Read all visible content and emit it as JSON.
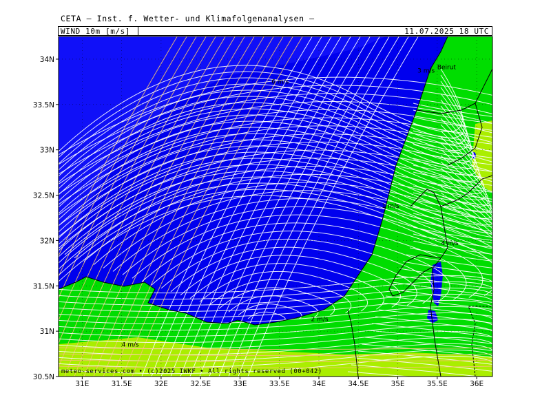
{
  "header": {
    "source": "CETA — Inst. f. Wetter- und Klimafolgenanalysen —",
    "variable": "WIND 10m [m/s]",
    "datetime": "11.07.2025 18 UTC"
  },
  "footer": {
    "credit": "meteo-services.com • (c)2025 IWKF • All rights reserved (00+042)"
  },
  "map": {
    "lon_range": [
      30.7,
      36.2
    ],
    "lat_range": [
      30.5,
      34.25
    ],
    "lon_ticks": [
      "31E",
      "31.5E",
      "32E",
      "32.5E",
      "33E",
      "33.5E",
      "34E",
      "34.5E",
      "35E",
      "35.5E",
      "36E"
    ],
    "lat_ticks": [
      "30.5N",
      "31N",
      "31.5N",
      "32N",
      "32.5N",
      "33N",
      "33.5N",
      "34N"
    ],
    "colors": {
      "sea_strong": "#0000ee",
      "land_light": "#00dd00",
      "land_weak": "#aaee00",
      "streamline_sea": "#ffffff",
      "streamline_fast": "#f4c070"
    },
    "place_labels": [
      {
        "text": "Beirut",
        "lon": 35.5,
        "lat": 33.89
      }
    ],
    "speed_labels": [
      {
        "text": "3 m/s",
        "lon": 35.25,
        "lat": 33.85
      },
      {
        "text": "6 m/s",
        "lon": 33.4,
        "lat": 33.73
      },
      {
        "text": "1 m/s",
        "lon": 34.8,
        "lat": 32.36
      },
      {
        "text": "4 m/s",
        "lon": 35.55,
        "lat": 31.95
      },
      {
        "text": "2 m/s",
        "lon": 33.9,
        "lat": 31.11
      },
      {
        "text": "4 m/s",
        "lon": 31.5,
        "lat": 30.83
      }
    ]
  }
}
